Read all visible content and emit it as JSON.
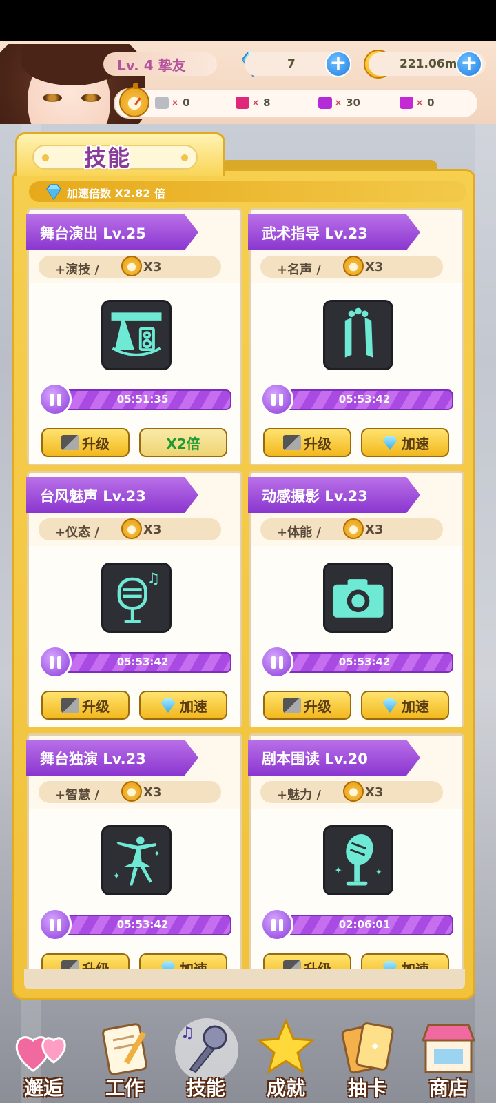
{
  "header": {
    "level_label": "Lv. 4 挚友",
    "diamonds": "7",
    "coins": "221.06m",
    "coin_glyph": "M",
    "tickets": [
      {
        "color": "#b9bcc2",
        "count": "0"
      },
      {
        "color": "#e0287a",
        "count": "8"
      },
      {
        "color": "#b42bd8",
        "count": "30"
      },
      {
        "color": "#c42ad4",
        "count": "0"
      }
    ],
    "ticket_x": "×"
  },
  "panel": {
    "title": "技能",
    "speed_multiplier": "加速倍数 X2.82 倍"
  },
  "skills": [
    {
      "name": "舞台演出 Lv.25",
      "stat": "+演技 /",
      "mult": "X3",
      "icon": "stage-icon",
      "timer": "05:51:35",
      "btn_left": "升级",
      "btn_right": "X2倍",
      "progress": 1.0
    },
    {
      "name": "武术指导 Lv.23",
      "stat": "+名声 /",
      "mult": "X3",
      "icon": "nunchaku-icon",
      "timer": "05:53:42",
      "btn_left": "升级",
      "btn_right": "加速",
      "progress": 1.0
    },
    {
      "name": "台风魅声 Lv.23",
      "stat": "+仪态 /",
      "mult": "X3",
      "icon": "microphone-icon",
      "timer": "05:53:42",
      "btn_left": "升级",
      "btn_right": "加速",
      "progress": 1.0
    },
    {
      "name": "动感摄影 Lv.23",
      "stat": "+体能 /",
      "mult": "X3",
      "icon": "camera-icon",
      "timer": "05:53:42",
      "btn_left": "升级",
      "btn_right": "加速",
      "progress": 1.0
    },
    {
      "name": "舞台独演 Lv.23",
      "stat": "+智慧 /",
      "mult": "X3",
      "icon": "ballerina-icon",
      "timer": "05:53:42",
      "btn_left": "升级",
      "btn_right": "加速",
      "progress": 1.0
    },
    {
      "name": "剧本围读 Lv.20",
      "stat": "+魅力 /",
      "mult": "X3",
      "icon": "retro-mic-icon",
      "timer": "02:06:01",
      "btn_left": "升级",
      "btn_right": "加速",
      "progress": 1.0
    }
  ],
  "nav": [
    {
      "label": "邂逅",
      "icon": "hearts-icon"
    },
    {
      "label": "工作",
      "icon": "notepad-icon"
    },
    {
      "label": "技能",
      "icon": "mic-music-icon"
    },
    {
      "label": "成就",
      "icon": "star-icon"
    },
    {
      "label": "抽卡",
      "icon": "cards-icon"
    },
    {
      "label": "商店",
      "icon": "shop-icon"
    }
  ],
  "colors": {
    "accent_purple": "#8a36cf",
    "panel_gold": "#f1c23a",
    "button_gold": "#f2b81f"
  }
}
